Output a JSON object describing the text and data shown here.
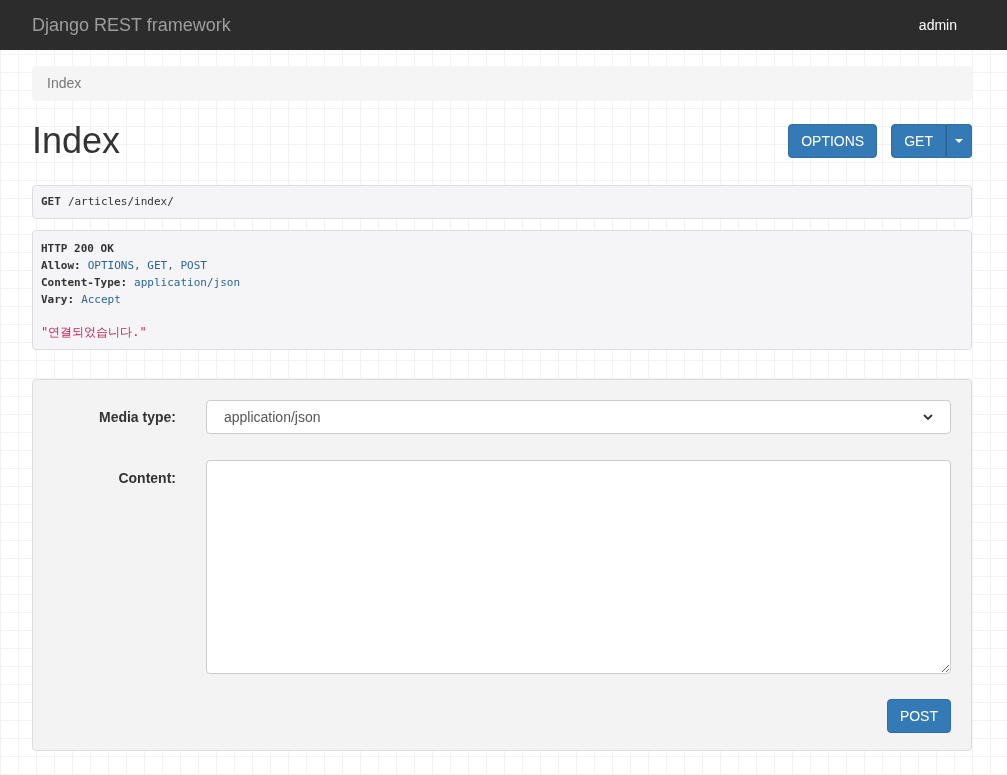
{
  "navbar": {
    "brand": "Django REST framework",
    "user": "admin"
  },
  "breadcrumb": [
    "Index"
  ],
  "page_title": "Index",
  "actions": [
    {
      "label": "OPTIONS",
      "kind": "button"
    },
    {
      "label": "GET",
      "kind": "split"
    }
  ],
  "request": {
    "method": "GET",
    "path": "/articles/index/"
  },
  "response": {
    "status": "HTTP 200 OK",
    "headers": [
      {
        "name": "Allow:",
        "value": "OPTIONS, GET, POST"
      },
      {
        "name": "Content-Type:",
        "value": "application/json"
      },
      {
        "name": "Vary:",
        "value": "Accept"
      }
    ],
    "body": "\"연결되었습니다.\""
  },
  "form": {
    "media_type_label": "Media type:",
    "media_type_value": "application/json",
    "content_label": "Content:",
    "submit": "POST"
  }
}
